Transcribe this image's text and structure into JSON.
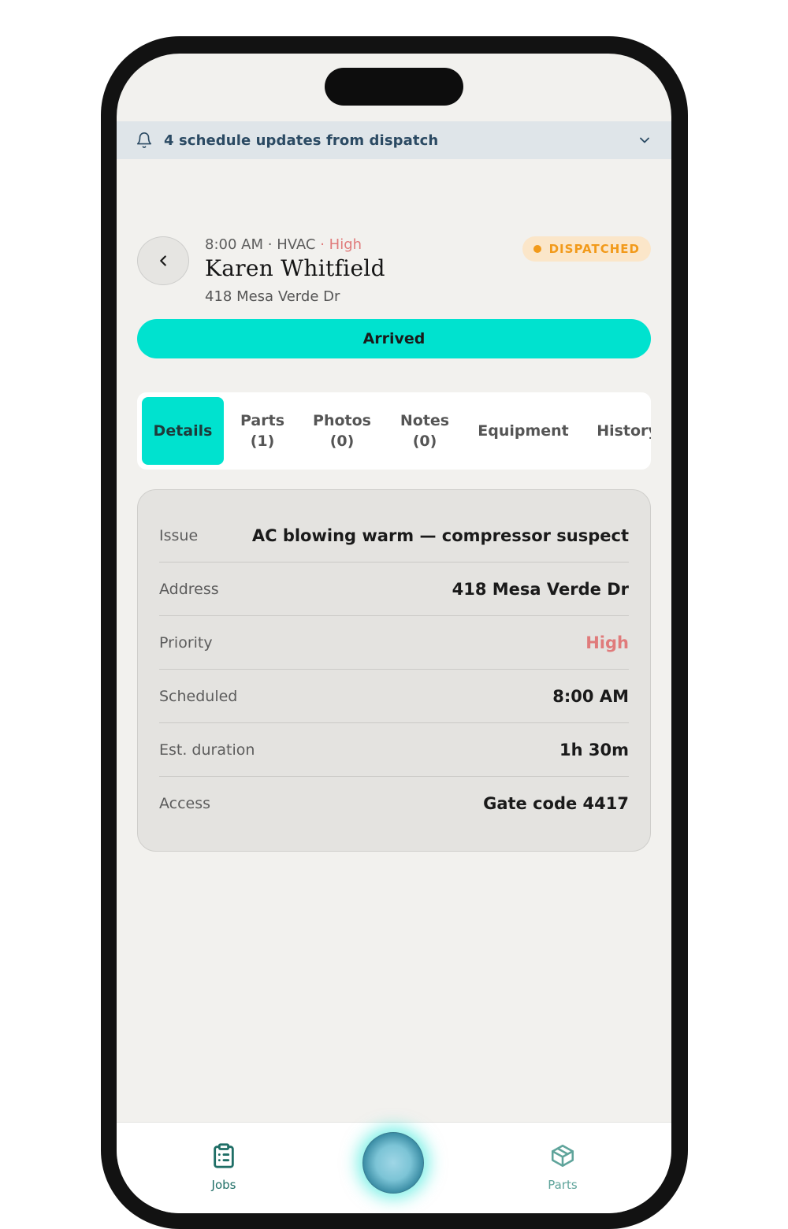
{
  "notification": {
    "text": "4 schedule updates from dispatch",
    "icon": "bell-icon",
    "expand_icon": "chevron-down-icon"
  },
  "job": {
    "time": "8:00 AM",
    "separator": "·",
    "category": "HVAC",
    "priority": "High",
    "customer_name": "Karen Whitfield",
    "address": "418 Mesa Verde Dr",
    "status": "DISPATCHED"
  },
  "actions": {
    "arrived_label": "Arrived"
  },
  "tabs": [
    {
      "label": "Details",
      "active": true
    },
    {
      "label": "Parts\n(1)",
      "active": false
    },
    {
      "label": "Photos\n(0)",
      "active": false
    },
    {
      "label": "Notes\n(0)",
      "active": false
    },
    {
      "label": "Equipment",
      "active": false
    },
    {
      "label": "History",
      "active": false
    }
  ],
  "details": [
    {
      "key": "Issue",
      "value": "AC blowing warm — compressor suspect"
    },
    {
      "key": "Address",
      "value": "418 Mesa Verde Dr"
    },
    {
      "key": "Priority",
      "value": "High"
    },
    {
      "key": "Scheduled",
      "value": "8:00 AM"
    },
    {
      "key": "Est. duration",
      "value": "1h 30m"
    },
    {
      "key": "Access",
      "value": "Gate code 4417"
    }
  ],
  "bottom_nav": {
    "jobs_label": "Jobs",
    "parts_label": "Parts",
    "jobs_icon": "clipboard-list-icon",
    "parts_icon": "box-icon"
  },
  "colors": {
    "accent": "#00e2cf",
    "priority_high": "#e07b7b",
    "status_dispatched": "#f29a1a",
    "banner_bg": "#dfe5e9",
    "nav_active": "#1f6e66",
    "nav_inactive": "#5fa49b"
  }
}
